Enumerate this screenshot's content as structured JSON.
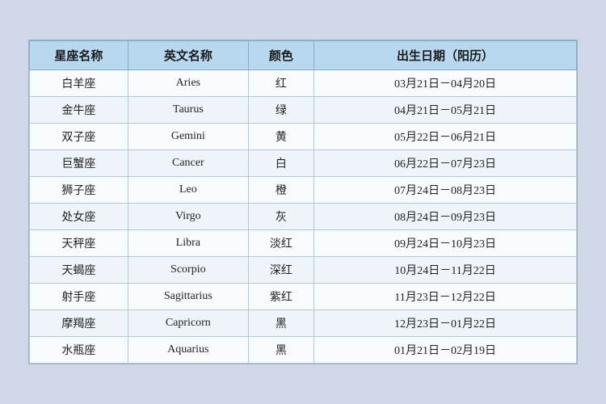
{
  "table": {
    "headers": {
      "chinese_name": "星座名称",
      "english_name": "英文名称",
      "color": "颜色",
      "birth_date": "出生日期（阳历）"
    },
    "rows": [
      {
        "chinese": "白羊座",
        "english": "Aries",
        "color": "红",
        "date": "03月21日－04月20日"
      },
      {
        "chinese": "金牛座",
        "english": "Taurus",
        "color": "绿",
        "date": "04月21日－05月21日"
      },
      {
        "chinese": "双子座",
        "english": "Gemini",
        "color": "黄",
        "date": "05月22日－06月21日"
      },
      {
        "chinese": "巨蟹座",
        "english": "Cancer",
        "color": "白",
        "date": "06月22日－07月23日"
      },
      {
        "chinese": "狮子座",
        "english": "Leo",
        "color": "橙",
        "date": "07月24日－08月23日"
      },
      {
        "chinese": "处女座",
        "english": "Virgo",
        "color": "灰",
        "date": "08月24日－09月23日"
      },
      {
        "chinese": "天秤座",
        "english": "Libra",
        "color": "淡红",
        "date": "09月24日－10月23日"
      },
      {
        "chinese": "天蝎座",
        "english": "Scorpio",
        "color": "深红",
        "date": "10月24日－11月22日"
      },
      {
        "chinese": "射手座",
        "english": "Sagittarius",
        "color": "紫红",
        "date": "11月23日－12月22日"
      },
      {
        "chinese": "摩羯座",
        "english": "Capricorn",
        "color": "黑",
        "date": "12月23日－01月22日"
      },
      {
        "chinese": "水瓶座",
        "english": "Aquarius",
        "color": "黑",
        "date": "01月21日－02月19日"
      }
    ]
  }
}
